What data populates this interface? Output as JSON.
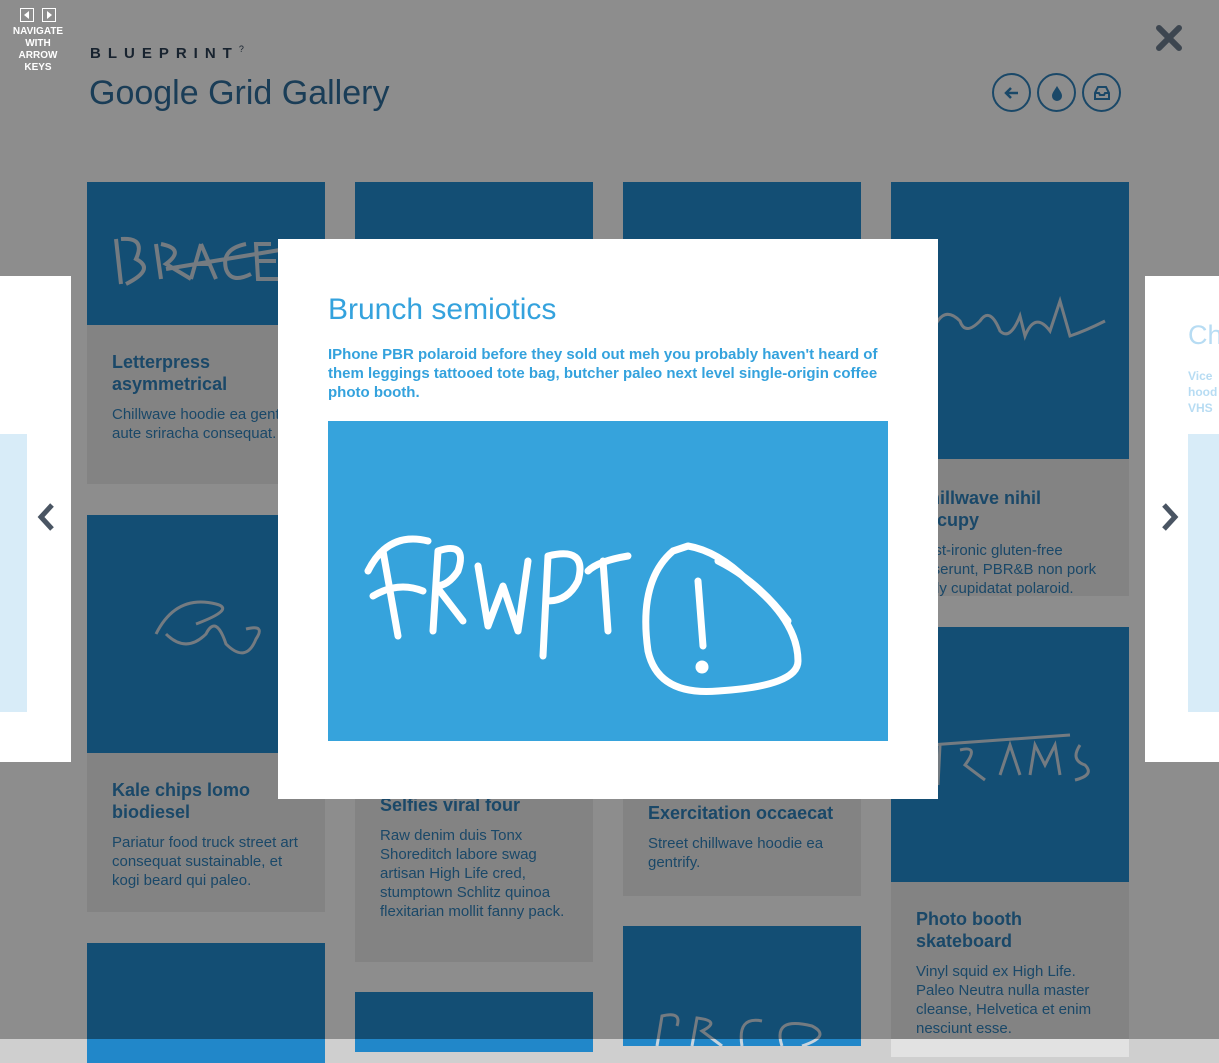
{
  "header": {
    "brand": "BLUEPRINT",
    "brand_mark": "?",
    "title": "Google Grid Gallery",
    "buttons": [
      "arrow-left-icon",
      "drop-icon",
      "archive-icon"
    ]
  },
  "grid": {
    "cards": [
      {
        "title": "Letterpress asymmetrical",
        "desc": "Chillwave hoodie ea gentrify aute sriracha consequat."
      },
      {
        "title": "Kale chips lomo biodiesel",
        "desc": "Pariatur food truck street art consequat sustainable, et kogi beard qui paleo."
      },
      {
        "title": "Selfies viral four",
        "desc": "Raw denim duis Tonx Shoreditch labore swag artisan High Life cred, stumptown Schlitz quinoa flexitarian mollit fanny pack."
      },
      {
        "title": "Exercitation occaecat",
        "desc": "Street chillwave hoodie ea gentrify."
      },
      {
        "title": "Chillwave nihil occupy",
        "desc": "Post-ironic gluten-free deserunt, PBR&B non pork belly cupidatat polaroid."
      },
      {
        "title": "Photo booth skateboard",
        "desc": "Vinyl squid ex High Life. Paleo Neutra nulla master cleanse, Helvetica et enim nesciunt esse."
      }
    ]
  },
  "modal": {
    "title": "Brunch semiotics",
    "description": "IPhone PBR polaroid before they sold out meh you probably haven't heard of them leggings tattooed tote bag, butcher paleo next level single-origin coffee photo booth."
  },
  "peek_right": {
    "title": "Ch",
    "text_lines": [
      "Vice",
      "hood",
      "VHS"
    ]
  },
  "nav_hint": {
    "text": "NAVIGATE WITH ARROW KEYS"
  },
  "colors": {
    "accent": "#34a2dd",
    "dark_blue": "#2e6a96",
    "overlay": "rgba(0,0,0,0.42)"
  }
}
